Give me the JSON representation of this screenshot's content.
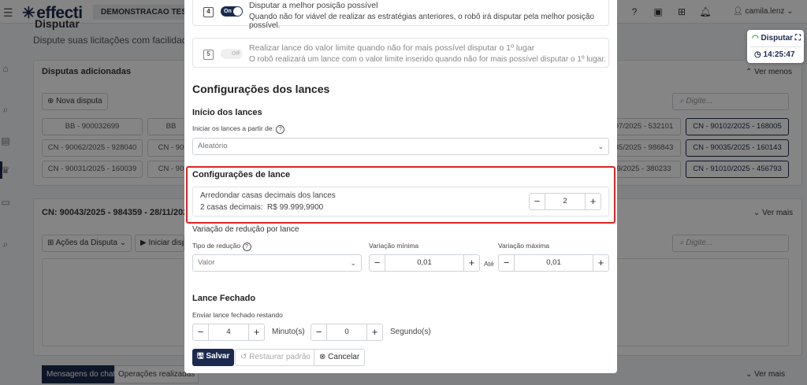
{
  "topbar": {
    "brand": "effecti",
    "company": "DEMONSTRACAO TES",
    "user": "camila.lenz"
  },
  "page": {
    "title": "Disputar",
    "subtitle": "Dispute suas licitações com facilidade e d"
  },
  "disputes_card": {
    "title": "Disputas adicionadas",
    "toggle_label": "Ver menos",
    "new_button": "Nova disputa",
    "search_placeholder": "Digite...",
    "row1_left": [
      "BB - 900032699",
      "BB"
    ],
    "row2_left": [
      "CN - 90062/2025 - 928040",
      "CN - 90"
    ],
    "row3_left": [
      "CN - 90031/2025 - 160039",
      "CN - 90"
    ],
    "row1_right": [
      "97/2025 - 532101",
      "CN - 90102/2025 - 168005"
    ],
    "row2_right": [
      "35/2025 - 986843",
      "CN - 90035/2025 - 160143"
    ],
    "row3_right": [
      "9/2025 - 380233",
      "CN - 91010/2025 - 456793"
    ]
  },
  "detail_card": {
    "title": "CN: 90043/2025 - 984359 - 28/11/202",
    "toggle_label": "Ver mais",
    "actions_button": "Ações da Disputa",
    "start_button": "Iniciar disp",
    "search_placeholder": "Digite..."
  },
  "bottom": {
    "tab_chat": "Mensagens do chat",
    "tab_ops": "Operações realizadas",
    "toggle_label": "Ver mais"
  },
  "float_widget": {
    "label": "Disputar",
    "time": "14:25:47"
  },
  "modal": {
    "strategy4": {
      "number": "4",
      "toggle": "On",
      "title": "Disputar a melhor posição possível",
      "desc": "Quando não for viável de realizar as estratégias anteriores, o robô irá disputar pela melhor posição possível."
    },
    "strategy5": {
      "number": "5",
      "toggle": "Off",
      "title": "Realizar lance do valor limite quando não for mais possível disputar o 1º lugar",
      "desc": "O robô realizará um lance com o valor limite inserido quando não for mais possível disputar o 1º lugar."
    },
    "bids_title": "Configurações dos lances",
    "start_section": "Início dos lances",
    "start_label": "Iniciar os lances a partir de:",
    "start_value": "Aleatório",
    "bid_config_title": "Configurações de lance",
    "round_title": "Arredondar casas decimais dos lances",
    "round_desc": "2 casas decimais:",
    "round_example": "R$ 99.999,9900",
    "round_value": "2",
    "variation_title": "Variação de redução por lance",
    "reduction_type_label": "Tipo de redução",
    "reduction_type_value": "Valor",
    "min_label": "Variação mínima",
    "min_value": "0,01",
    "ate": "Até",
    "max_label": "Variação máxima",
    "max_value": "0,01",
    "closed_title": "Lance Fechado",
    "closed_label": "Enviar lance fechado restando",
    "minutes_value": "4",
    "minutes_label": "Minuto(s)",
    "seconds_value": "0",
    "seconds_label": "Segundo(s)",
    "save": "Salvar",
    "restore": "Restaurar padrão",
    "cancel": "Cancelar"
  },
  "colors": {
    "navy": "#1b2a4e",
    "highlight": "#e02424",
    "wifi": "#2e9e3e"
  }
}
